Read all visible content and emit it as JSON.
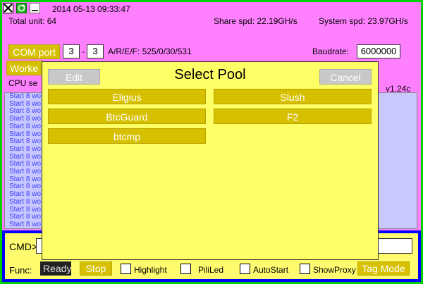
{
  "topbar": {
    "datetime": "2014 05-13 09:33:47",
    "total_unit": "Total unit: 64",
    "share_spd": "Share spd: 22.19GH/s",
    "system_spd": "System spd: 23.97GH/s"
  },
  "com": {
    "label": "COM port",
    "from": "3",
    "dash": "-",
    "to": "3",
    "aref": "A/R/E/F: 525/0/30/531",
    "baud_label": "Baudrate:",
    "baud_value": "6000000"
  },
  "worker_label": "Worke",
  "cpu_label": "CPU se",
  "version": "v1.24c",
  "log_lines": [
    "Start 8 wo",
    "Start 8 wo",
    "Start 8 wo",
    "Start 8 wo",
    "Start 8 wo",
    "Start 8 wo",
    "Start 8 wo",
    "Start 8 wo",
    "Start 8 wo",
    "Start 8 wo",
    "Start 8 wo",
    "Start 8 wo",
    "Start 8 wo",
    "Start 8 wo",
    "Start 8 wo",
    "Start 8 wo",
    "Start 8 wo",
    "Start 8 wo"
  ],
  "dialog": {
    "title": "Select Pool",
    "edit": "Edit",
    "cancel": "Cancel",
    "pools": [
      "Eligius",
      "Slush",
      "BtcGuard",
      "F2",
      "btcmp"
    ]
  },
  "bottom": {
    "cmd_label": "CMD>",
    "cmd_value": "",
    "func_label": "Func:",
    "ready": "Ready",
    "stop": "Stop",
    "highlight": "Highlight",
    "piliLed": "PiliLed",
    "autostart": "AutoStart",
    "showproxy": "ShowProxy",
    "tagmode": "Tag Mode"
  },
  "colors": {
    "frame": "#00d000",
    "background": "#ff80ff",
    "button": "#d6c000",
    "dialog": "#ffff66",
    "log_bg": "#c8c8ff",
    "log_text": "#4040ff",
    "bottom_border": "#0000ff"
  },
  "icons": [
    "close-icon",
    "refresh-icon",
    "minimize-icon"
  ]
}
